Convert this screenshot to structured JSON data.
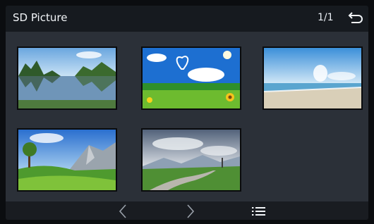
{
  "header": {
    "title": "SD Picture",
    "page_indicator": "1/1",
    "back_icon": "back-arrow-icon"
  },
  "gallery": {
    "items": [
      {
        "subject": "lake-with-trees"
      },
      {
        "subject": "sky-heart-cloud-sunflower"
      },
      {
        "subject": "beach-shoreline"
      },
      {
        "subject": "green-valley-mountains"
      },
      {
        "subject": "winding-path-mountains"
      }
    ]
  },
  "toolbar": {
    "prev_icon": "chevron-left-icon",
    "next_icon": "chevron-right-icon",
    "menu_icon": "list-menu-icon"
  },
  "colors": {
    "background": "#2b3038",
    "header": "#161a1f",
    "toolbar": "#191c21",
    "text": "#f2f5f8"
  }
}
